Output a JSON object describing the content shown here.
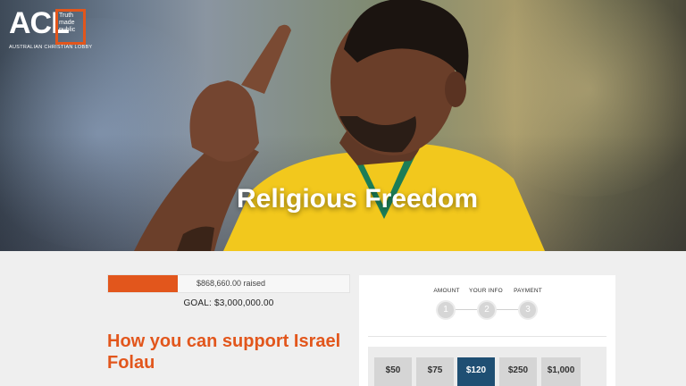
{
  "logo": {
    "acl": "ACL",
    "tagline": "Truth made public",
    "subtitle": "AUSTRALIAN CHRISTIAN LOBBY"
  },
  "hero": {
    "title": "Religious Freedom"
  },
  "fundraiser": {
    "raised_text": "$868,660.00 raised",
    "goal_text": "GOAL: $3,000,000.00",
    "progress_fraction": 0.29
  },
  "headline": "How you can support Israel Folau",
  "steps": [
    {
      "label": "AMOUNT",
      "number": "1"
    },
    {
      "label": "YOUR INFO",
      "number": "2"
    },
    {
      "label": "PAYMENT",
      "number": "3"
    }
  ],
  "amounts": [
    "$50",
    "$75",
    "$120",
    "$250",
    "$1,000"
  ],
  "selected_amount": "$120",
  "colors": {
    "accent": "#e2561c",
    "selected": "#1f4f73",
    "jersey": "#f2c81d"
  }
}
